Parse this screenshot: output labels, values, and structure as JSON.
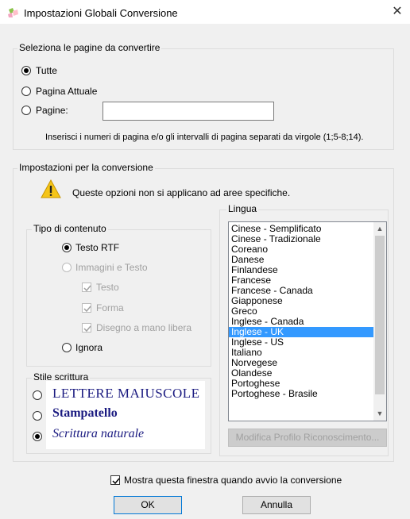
{
  "window": {
    "title": "Impostazioni Globali Conversione",
    "close_icon": "close-icon",
    "app_icon": "scanner-app-icon"
  },
  "pages_group": {
    "legend": "Seleziona le pagine da convertire",
    "options": [
      {
        "label": "Tutte",
        "selected": true
      },
      {
        "label": "Pagina Attuale",
        "selected": false
      },
      {
        "label": "Pagine:",
        "selected": false
      }
    ],
    "pages_value": "",
    "hint": "Inserisci i numeri di pagina e/o gli intervalli di pagina separati da virgole (1;5-8;14)."
  },
  "conversion_group": {
    "legend": "Impostazioni per la conversione",
    "warning": "Queste opzioni non si applicano ad aree specifiche.",
    "warning_icon": "warning-icon",
    "content_type": {
      "legend": "Tipo di contenuto",
      "options": [
        {
          "label": "Testo RTF",
          "selected": true,
          "enabled": true
        },
        {
          "label": "Immagini e Testo",
          "selected": false,
          "enabled": false
        },
        {
          "label": "Ignora",
          "selected": false,
          "enabled": true
        }
      ],
      "sub_options": [
        {
          "label": "Testo",
          "checked": true
        },
        {
          "label": "Forma",
          "checked": true
        },
        {
          "label": "Disegno a mano libera",
          "checked": true
        }
      ]
    },
    "writing_style": {
      "legend": "Stile scrittura",
      "options": [
        {
          "label": "LETTERE MAIUSCOLE",
          "selected": false
        },
        {
          "label": "Stampatello",
          "selected": false
        },
        {
          "label": "Scrittura naturale",
          "selected": true
        }
      ]
    },
    "language": {
      "legend": "Lingua",
      "items": [
        "Cinese - Semplificato",
        "Cinese - Tradizionale",
        "Coreano",
        "Danese",
        "Finlandese",
        "Francese",
        "Francese - Canada",
        "Giapponese",
        "Greco",
        "Inglese - Canada",
        "Inglese - UK",
        "Inglese - US",
        "Italiano",
        "Norvegese",
        "Olandese",
        "Portoghese",
        "Portoghese - Brasile"
      ],
      "selected": "Inglese - UK",
      "modify_button": "Modifica Profilo Riconoscimento..."
    }
  },
  "footer": {
    "show_checkbox": "Mostra questa finestra quando avvio la conversione",
    "show_checked": true,
    "ok": "OK",
    "cancel": "Annulla"
  }
}
